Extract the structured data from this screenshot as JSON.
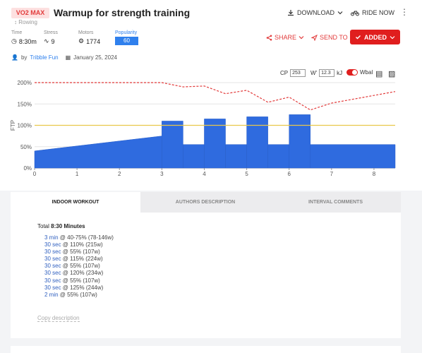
{
  "header": {
    "badge": "VO2 MAX",
    "subtype": "Rowing",
    "title": "Warmup for strength training",
    "download_label": "DOWNLOAD",
    "ride_now_label": "RIDE NOW",
    "kebab": "⋮"
  },
  "stats": {
    "time_label": "Time",
    "time_value": "8:30m",
    "stress_label": "Stress",
    "stress_value": "9",
    "motors_label": "Motors",
    "motors_value": "1774",
    "popularity_label": "Popularity",
    "popularity_value": "60"
  },
  "actions": {
    "share_label": "SHARE",
    "send_label": "SEND TO",
    "added_label": "ADDED"
  },
  "author": {
    "by": "by",
    "name": "Tribble Fun",
    "date": "January 25, 2024"
  },
  "controls": {
    "cp_label": "CP",
    "cp_value": "253",
    "w_label": "W'",
    "w_value": "12.3",
    "w_unit": "kJ",
    "wbal_label": "Wbal"
  },
  "chart_data": {
    "type": "area",
    "ylabel": "FTP",
    "y_tick_labels": [
      "0%",
      "50%",
      "100%",
      "150%",
      "200%"
    ],
    "x_tick_labels": [
      "0",
      "1",
      "2",
      "3",
      "4",
      "5",
      "6",
      "7",
      "8"
    ],
    "xlim": [
      0,
      8.5
    ],
    "ylim": [
      0,
      200
    ],
    "ftp_line": 100,
    "power_segments": [
      {
        "start": 0,
        "end": 3,
        "from": 40,
        "to": 75
      },
      {
        "start": 3,
        "end": 3.5,
        "from": 110,
        "to": 110
      },
      {
        "start": 3.5,
        "end": 4,
        "from": 55,
        "to": 55
      },
      {
        "start": 4,
        "end": 4.5,
        "from": 115,
        "to": 115
      },
      {
        "start": 4.5,
        "end": 5,
        "from": 55,
        "to": 55
      },
      {
        "start": 5,
        "end": 5.5,
        "from": 120,
        "to": 120
      },
      {
        "start": 5.5,
        "end": 6,
        "from": 55,
        "to": 55
      },
      {
        "start": 6,
        "end": 6.5,
        "from": 125,
        "to": 125
      },
      {
        "start": 6.5,
        "end": 8.5,
        "from": 55,
        "to": 55
      }
    ],
    "wbal_series": {
      "x": [
        0,
        3,
        3.5,
        4,
        4.5,
        5,
        5.5,
        6,
        6.5,
        7,
        8.5
      ],
      "values": [
        200,
        200,
        190,
        192,
        174,
        182,
        154,
        166,
        136,
        152,
        179
      ]
    }
  },
  "tabs": {
    "indoor": "INDOOR WORKOUT",
    "authors": "AUTHORS DESCRIPTION",
    "comments": "INTERVAL COMMENTS"
  },
  "workout": {
    "total_prefix": "Total",
    "total_value": "8:30 Minutes",
    "intervals": [
      {
        "dur": "3 min",
        "rest": " @ 40-75% (78-146w)"
      },
      {
        "dur": "30 sec",
        "rest": " @ 110% (215w)"
      },
      {
        "dur": "30 sec",
        "rest": " @ 55% (107w)"
      },
      {
        "dur": "30 sec",
        "rest": " @ 115% (224w)"
      },
      {
        "dur": "30 sec",
        "rest": " @ 55% (107w)"
      },
      {
        "dur": "30 sec",
        "rest": " @ 120% (234w)"
      },
      {
        "dur": "30 sec",
        "rest": " @ 55% (107w)"
      },
      {
        "dur": "30 sec",
        "rest": " @ 125% (244w)"
      },
      {
        "dur": "2 min",
        "rest": " @ 55% (107w)"
      }
    ],
    "copy_label": "Copy description"
  },
  "colors": {
    "accent": "#e01e1e",
    "bars": "#2f6bdf",
    "ftp": "#e8c84a",
    "wbal": "#e23b3b",
    "link": "#2f80ed"
  }
}
